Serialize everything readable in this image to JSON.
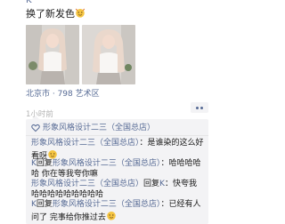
{
  "post": {
    "author": "K",
    "text": "换了新发色",
    "location": "北京市 · 798 艺术区",
    "time": "1小时前"
  },
  "likes": {
    "names": "形象风格设计二三（全国总店）"
  },
  "comments": [
    {
      "name": "形象风格设计二三（全国总店）",
      "text": "：是谁染的这么好看呀"
    },
    {
      "name": "K",
      "reply_word": "回复",
      "target": "形象风格设计二三（全国总店）",
      "text": "：哈哈哈哈哈 你在等我夸你嘛"
    },
    {
      "name": "形象风格设计二三（全国总店）",
      "reply_word": "回复",
      "target": "K",
      "text": "：快夸我 哈哈哈哈哈哈哈哈哈"
    },
    {
      "name": "K",
      "reply_word": "回复",
      "target": "形象风格设计二三（全国总店）",
      "text": "：已经有人问了 完事给你推过去"
    }
  ],
  "colors": {
    "link": "#576b95",
    "comment_bg": "#f3f3f5",
    "time": "#b2b2b2"
  },
  "icons": [
    "emoji-face-icon",
    "heart-icon",
    "more-dots-icon"
  ]
}
